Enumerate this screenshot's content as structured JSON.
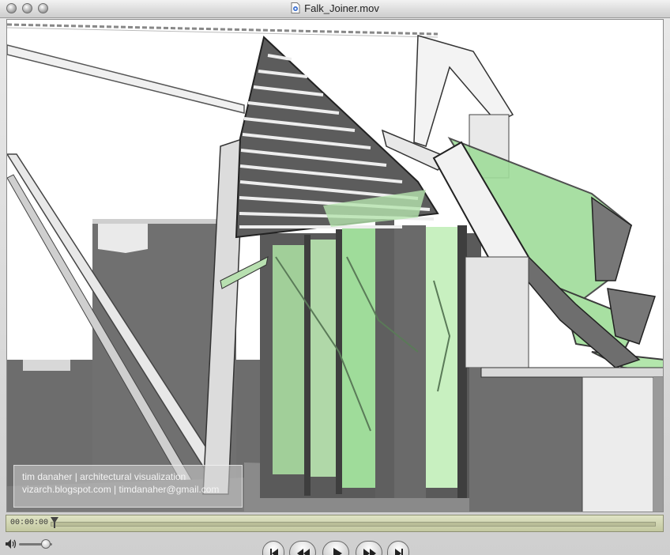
{
  "window": {
    "title": "Falk_Joiner.mov",
    "title_icon": "quicktime-document-icon"
  },
  "video": {
    "description": "architectural 3D rendering of a building entrance with glass doors and slatted canopy",
    "watermark": {
      "line1": "tim danaher | architectural visualization",
      "line2": "vizarch.blogspot.com | timdanaher@gmail.com"
    },
    "palette": {
      "glass_green": "#9fdc9a",
      "wall_gray": "#6f6f6f",
      "dark_gray": "#4a4a4a",
      "light_gray": "#e6e6e6"
    }
  },
  "scrubber": {
    "time": "00:00:00",
    "progress_fraction": 0
  },
  "controls": {
    "volume_fraction": 0.8,
    "buttons": [
      {
        "name": "go-to-start-button",
        "icon": "skip-back-icon"
      },
      {
        "name": "rewind-button",
        "icon": "rewind-icon"
      },
      {
        "name": "play-button",
        "icon": "play-icon"
      },
      {
        "name": "fast-forward-button",
        "icon": "fast-forward-icon"
      },
      {
        "name": "go-to-end-button",
        "icon": "skip-forward-icon"
      }
    ]
  }
}
